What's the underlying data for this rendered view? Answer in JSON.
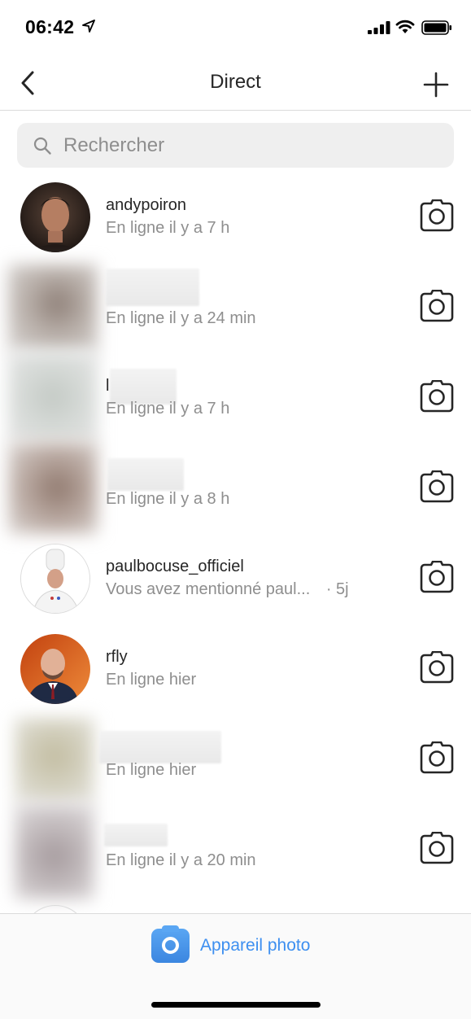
{
  "status_bar": {
    "time": "06:42",
    "icons": [
      "location-arrow-icon",
      "signal-icon",
      "wifi-icon",
      "battery-icon"
    ]
  },
  "nav": {
    "title": "Direct",
    "back_icon": "chevron-left-icon",
    "new_icon": "plus-icon"
  },
  "search": {
    "placeholder": "Rechercher",
    "value": ""
  },
  "conversations": [
    {
      "name": "andypoiron",
      "status": "En ligne il y a 7 h",
      "avatar_color": "#3b2a22"
    },
    {
      "name": "",
      "status": "En ligne il y a 24 min",
      "avatar_color": "#8d7e76"
    },
    {
      "name": "l",
      "status": "En ligne il y a 7 h",
      "avatar_color": "#c9cfc9"
    },
    {
      "name": "",
      "status": "En ligne il y a 8 h",
      "avatar_color": "#9c8378"
    },
    {
      "name": "paulbocuse_officiel",
      "status": "Vous avez mentionné paul...",
      "time": "· 5j",
      "avatar_color": "#ffffff"
    },
    {
      "name": "rfly",
      "status": "En ligne hier",
      "avatar_color": "#d7641f"
    },
    {
      "name": "",
      "status": "En ligne hier",
      "avatar_color": "#c5c1a7"
    },
    {
      "name": "",
      "status": "En ligne il y a 20 min",
      "avatar_color": "#a69b9e"
    }
  ],
  "bottom": {
    "camera_label": "Appareil photo",
    "accent": "#3d8ff0"
  }
}
